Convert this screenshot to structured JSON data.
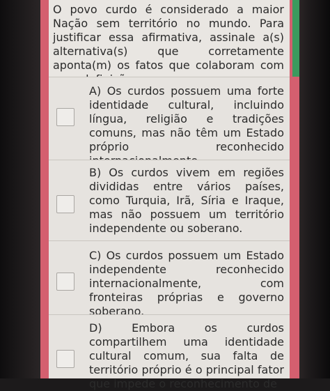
{
  "question": {
    "text": "O povo curdo é considerado a maior Nação sem território no mundo. Para justificar essa afirmativa, assinale a(s) alternativa(s) que corretamente aponta(m) os fatos que colaboram com essa definição."
  },
  "options": [
    {
      "text": "A) Os curdos possuem uma forte identidade cultural, incluindo língua, religião e tradições comuns, mas não têm um Estado próprio reconhecido internacionalmente."
    },
    {
      "text": "B) Os curdos vivem em regiões divididas entre vários países, como Turquia, Irã, Síria e Iraque, mas não possuem um território independente ou soberano."
    },
    {
      "text": "C) Os curdos possuem um Estado independente reconhecido internacionalmente, com fronteiras próprias e governo soberano."
    },
    {
      "text": "D) Embora os curdos compartilhem uma identidade cultural comum, sua falta de território próprio é o principal fator que impede o reconhecimento de"
    }
  ],
  "colors": {
    "frame": "#d45f6f",
    "accent_green": "#3c9a5e",
    "card": "#e6e3df"
  }
}
